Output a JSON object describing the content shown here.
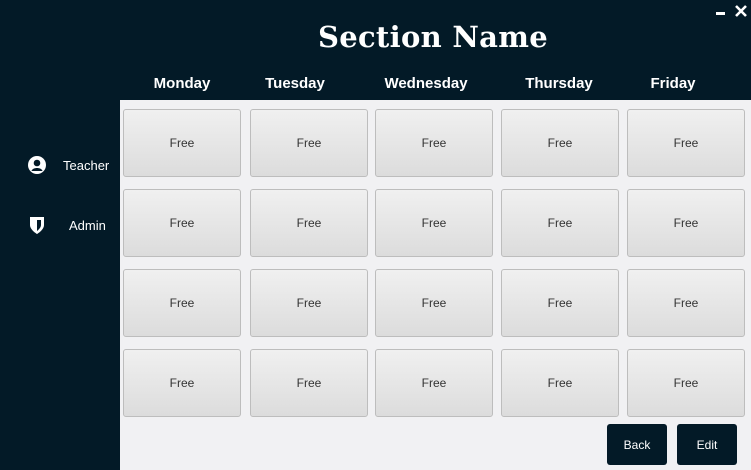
{
  "window": {
    "minimize_icon": "minimize-icon",
    "close_icon": "close-icon"
  },
  "header": {
    "title": "Section Name"
  },
  "sidebar": {
    "items": [
      {
        "label": "Teacher",
        "icon": "user-circle-icon"
      },
      {
        "label": "Admin",
        "icon": "shield-icon"
      }
    ]
  },
  "schedule": {
    "days": [
      "Monday",
      "Tuesday",
      "Wednesday",
      "Thursday",
      "Friday"
    ],
    "rows": [
      [
        "Free",
        "Free",
        "Free",
        "Free",
        "Free"
      ],
      [
        "Free",
        "Free",
        "Free",
        "Free",
        "Free"
      ],
      [
        "Free",
        "Free",
        "Free",
        "Free",
        "Free"
      ],
      [
        "Free",
        "Free",
        "Free",
        "Free",
        "Free"
      ]
    ]
  },
  "actions": {
    "back_label": "Back",
    "edit_label": "Edit"
  },
  "colors": {
    "background": "#031a27",
    "grid_background": "#f1f1f3",
    "slot": "#e6e6e6"
  }
}
